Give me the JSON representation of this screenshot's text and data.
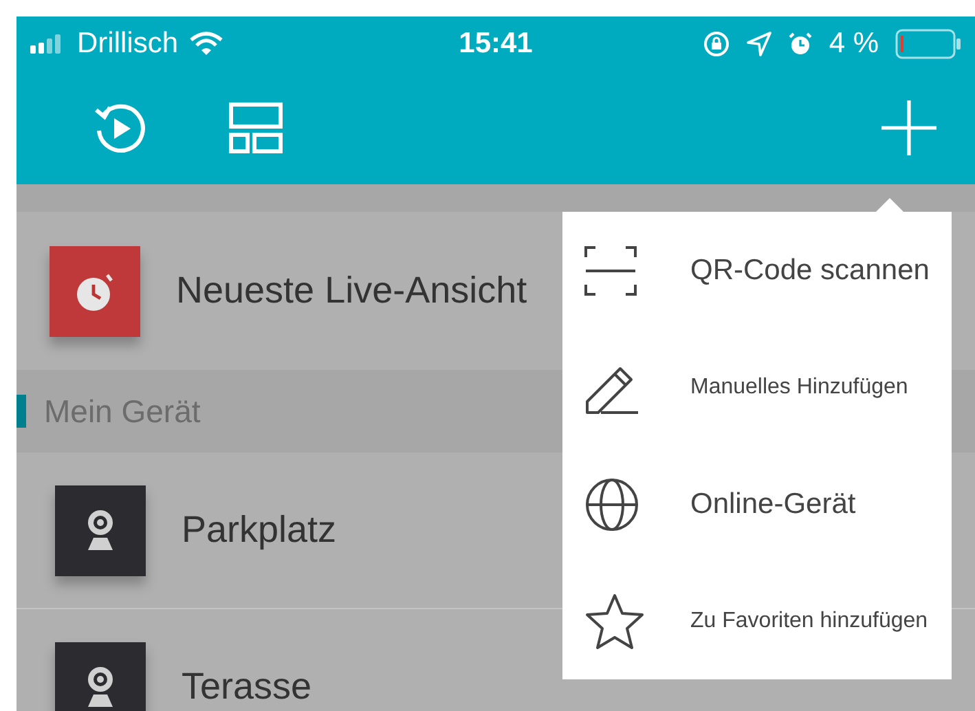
{
  "status_bar": {
    "carrier": "Drillisch",
    "time": "15:41",
    "battery": "4 %"
  },
  "list": [
    {
      "kind": "recent",
      "label": "Neueste Live-Ansicht"
    },
    {
      "kind": "section",
      "label": "Mein Gerät"
    },
    {
      "kind": "camera",
      "label": "Parkplatz"
    },
    {
      "kind": "camera",
      "label": "Terasse"
    }
  ],
  "add_menu": [
    {
      "kind": "scan",
      "label": "QR-Code scannen"
    },
    {
      "kind": "manual",
      "label": "Manuelles Hinzufügen"
    },
    {
      "kind": "online",
      "label": "Online-Gerät"
    },
    {
      "kind": "favorite",
      "label": "Zu Favoriten hinzufügen"
    }
  ]
}
